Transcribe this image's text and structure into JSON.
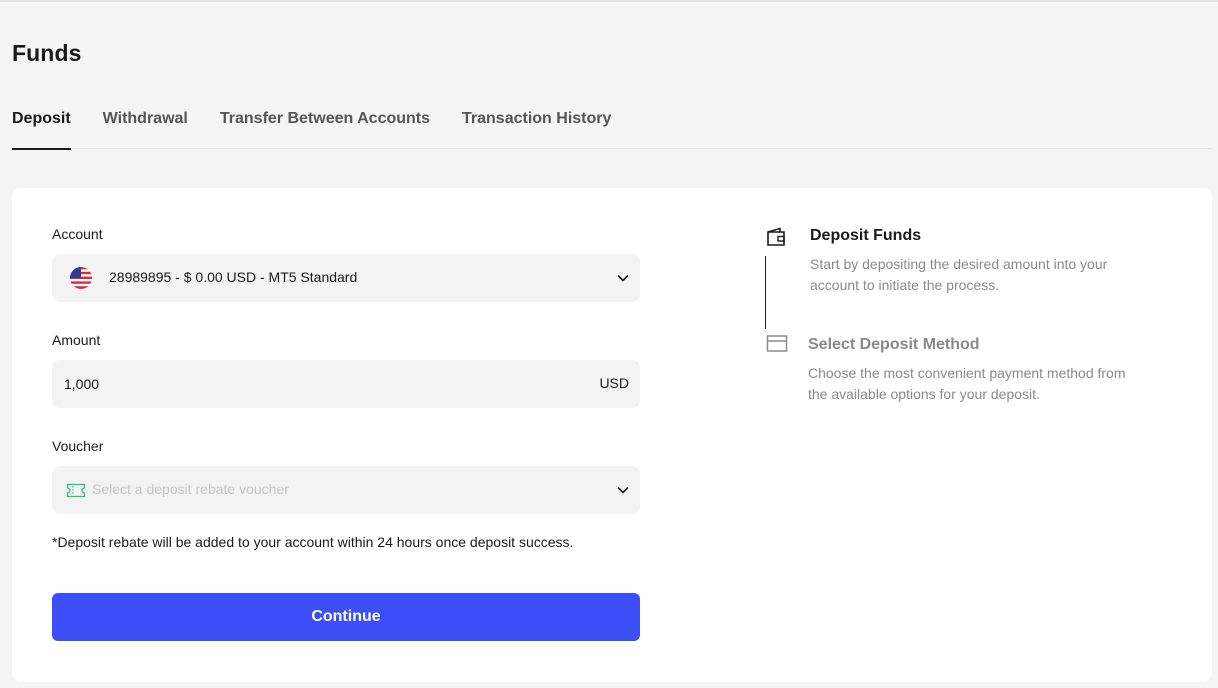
{
  "page": {
    "title": "Funds"
  },
  "tabs": [
    {
      "label": "Deposit",
      "active": true
    },
    {
      "label": "Withdrawal",
      "active": false
    },
    {
      "label": "Transfer Between Accounts",
      "active": false
    },
    {
      "label": "Transaction History",
      "active": false
    }
  ],
  "form": {
    "account": {
      "label": "Account",
      "value": "28989895 - $ 0.00 USD - MT5 Standard",
      "flag_icon": "us-flag-icon"
    },
    "amount": {
      "label": "Amount",
      "value": "1,000",
      "currency": "USD"
    },
    "voucher": {
      "label": "Voucher",
      "placeholder": "Select a deposit rebate voucher",
      "icon": "ticket-icon"
    },
    "note": "*Deposit rebate will be added to your account within 24 hours once deposit success.",
    "continue_label": "Continue"
  },
  "steps": [
    {
      "title": "Deposit Funds",
      "description": "Start by depositing the desired amount into your account to initiate the process.",
      "icon": "wallet-icon",
      "active": true
    },
    {
      "title": "Select Deposit Method",
      "description": "Choose the most convenient payment method from the available options for your deposit.",
      "icon": "card-icon",
      "active": false
    }
  ],
  "colors": {
    "primary": "#3b4ef8",
    "background": "#f5f5f5",
    "card": "#ffffff",
    "field": "#f3f3f3",
    "voucher_icon": "#2bbf7a"
  }
}
